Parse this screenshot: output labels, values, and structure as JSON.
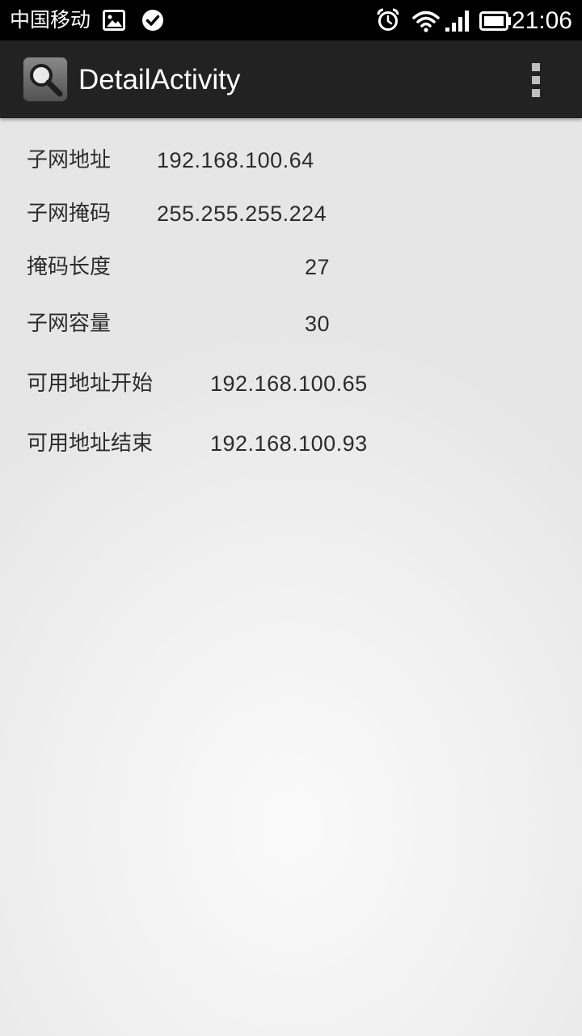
{
  "status_bar": {
    "carrier": "中国移动",
    "time": "21:06",
    "icons": [
      "image-icon",
      "check-circle-icon",
      "alarm-icon",
      "wifi-icon",
      "signal-icon",
      "battery-icon"
    ]
  },
  "action_bar": {
    "title": "DetailActivity",
    "app_icon": "search-magnifier-icon",
    "overflow_icon": "overflow-menu-icon"
  },
  "details": [
    {
      "label": "子网地址",
      "value": "192.168.100.64"
    },
    {
      "label": "子网掩码",
      "value": "255.255.255.224"
    },
    {
      "label": "掩码长度",
      "value": "27"
    },
    {
      "label": "子网容量",
      "value": "30"
    },
    {
      "label": "可用地址开始",
      "value": "192.168.100.65"
    },
    {
      "label": "可用地址结束",
      "value": "192.168.100.93"
    }
  ]
}
